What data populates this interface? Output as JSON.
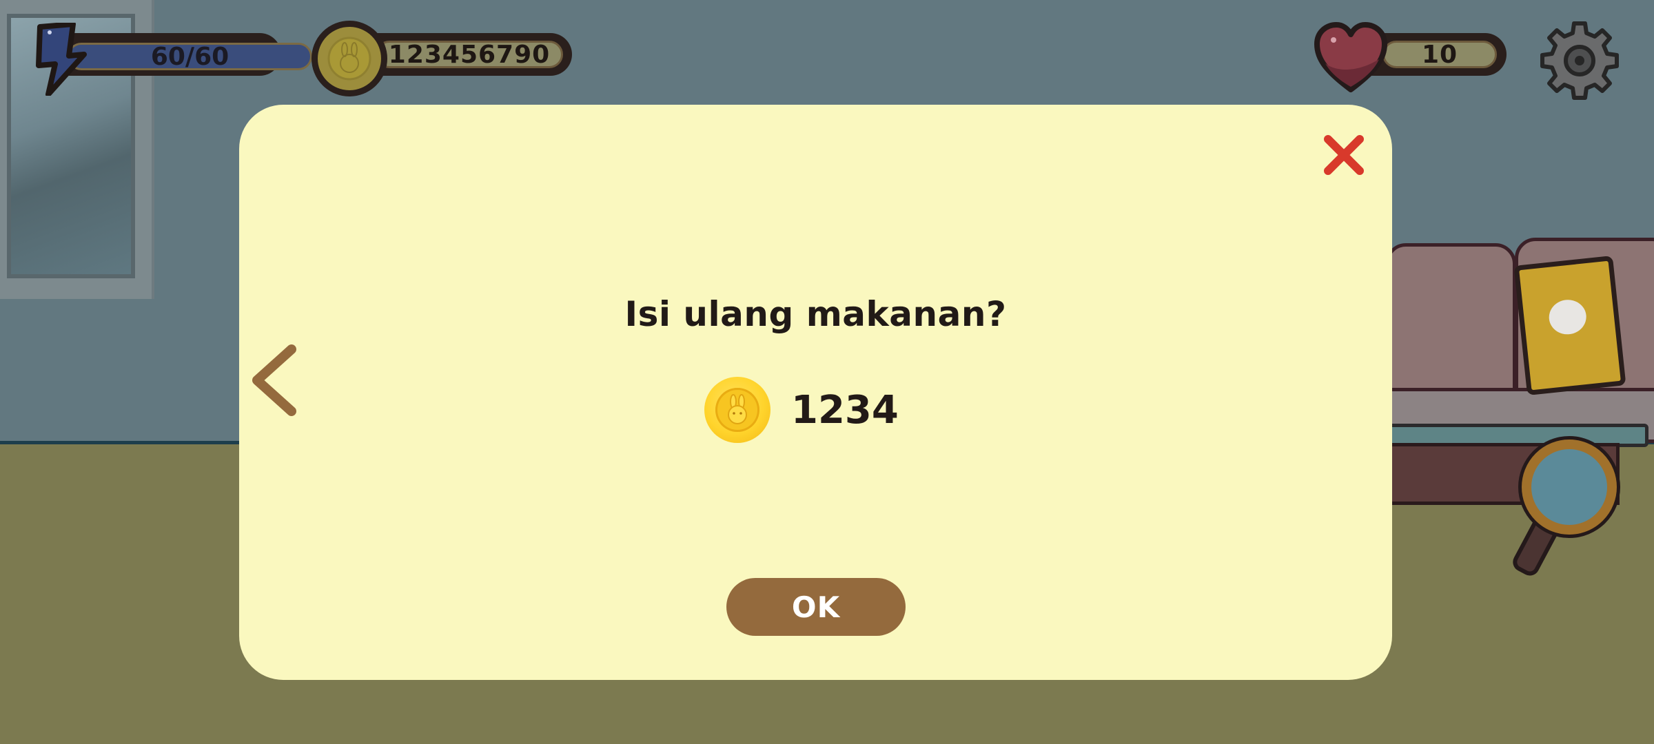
{
  "hud": {
    "energy": "60/60",
    "coins": "123456790",
    "hearts": "10"
  },
  "dialog": {
    "title": "Isi ulang makanan?",
    "price": "1234",
    "ok_label": "OK"
  },
  "icons": {
    "energy": "lightning-bolt-icon",
    "coin": "bunny-coin-icon",
    "heart": "heart-icon",
    "settings": "gear-icon",
    "close": "close-x-icon",
    "back": "chevron-left-icon",
    "book": "bunny-book-icon",
    "search": "magnifier-icon"
  },
  "colors": {
    "dialog_bg": "#faf8bf",
    "ok_button": "#946a3d",
    "close_x": "#d8392b",
    "back_arrow": "#946a3d",
    "coin": "#ffd42c"
  }
}
